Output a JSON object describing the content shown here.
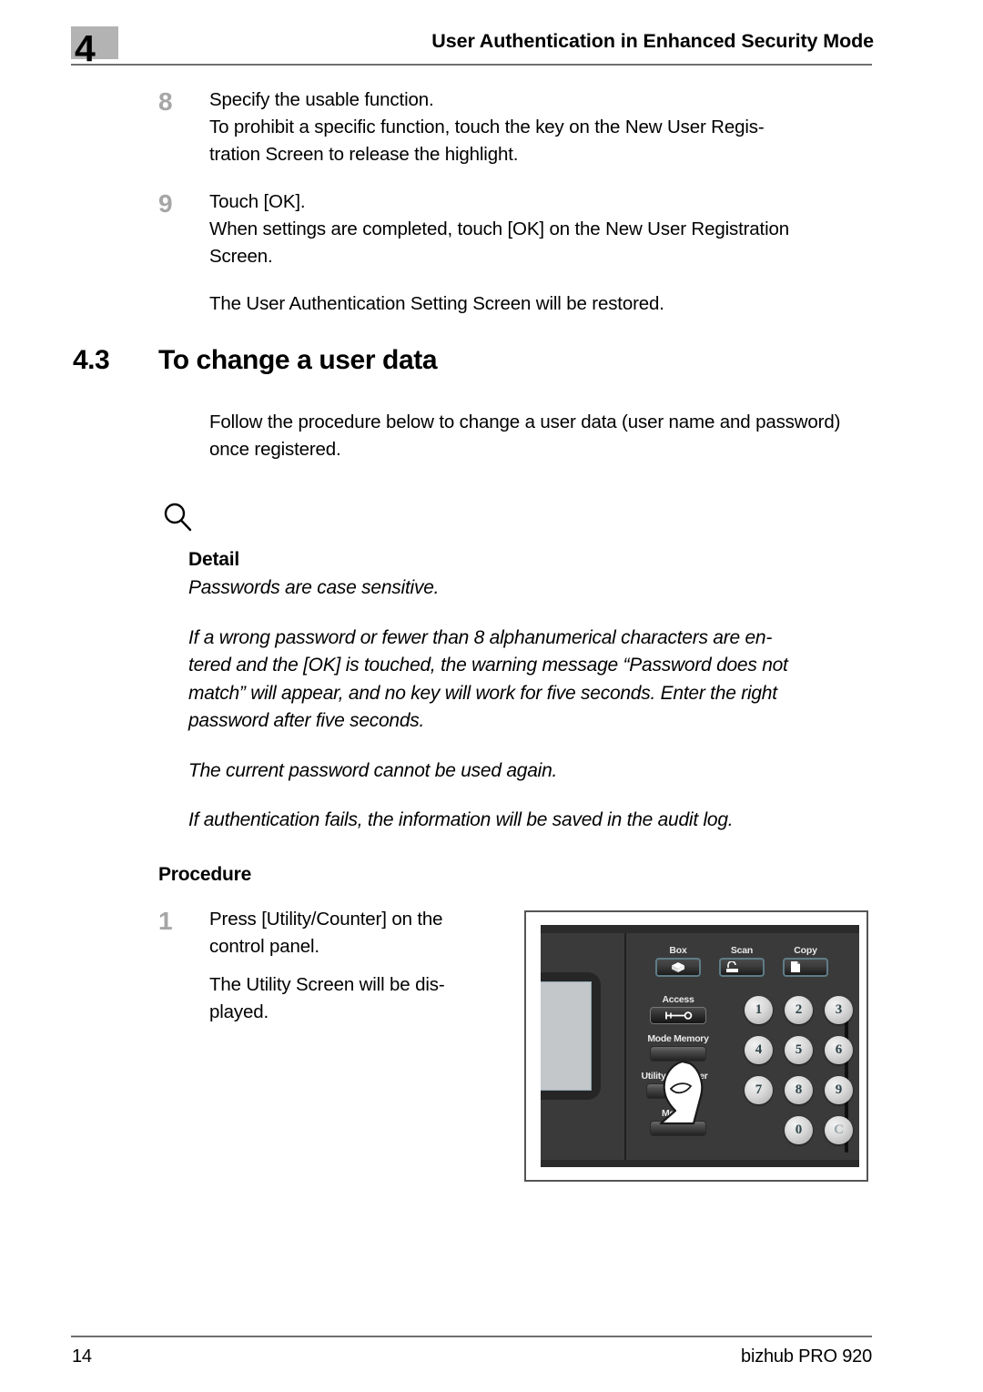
{
  "header": {
    "chapter_number": "4",
    "title": "User Authentication in Enhanced Security Mode"
  },
  "steps_continued": [
    {
      "number": "8",
      "lines": [
        "Specify the usable function.",
        "To prohibit a specific function, touch the key on the New User Regis-",
        "tration Screen to release the highlight."
      ]
    },
    {
      "number": "9",
      "lines": [
        "Touch [OK].",
        "When settings are completed, touch [OK] on the New User Registration",
        "Screen."
      ],
      "result": "The User Authentication Setting Screen will be restored."
    }
  ],
  "section": {
    "number": "4.3",
    "title": "To change a user data",
    "intro_lines": [
      "Follow the procedure below to change a user data (user name and password)",
      "once registered."
    ]
  },
  "detail": {
    "icon": "magnifier-icon",
    "heading": "Detail",
    "paragraphs": [
      [
        "Passwords are case sensitive."
      ],
      [
        "If a wrong password or fewer than 8 alphanumerical characters are en-",
        "tered and the [OK] is touched, the warning message “Password does not",
        "match” will appear, and no key will work for five seconds. Enter the right",
        "password after five seconds."
      ],
      [
        "The current password cannot be used again."
      ],
      [
        "If authentication fails, the information will be saved in the audit log."
      ]
    ]
  },
  "procedure": {
    "heading": "Procedure",
    "step": {
      "number": "1",
      "lines": [
        "Press [Utility/Counter] on the",
        "control panel."
      ],
      "result_lines": [
        "The Utility Screen will be dis-",
        "played."
      ]
    }
  },
  "control_panel": {
    "function_keys": [
      {
        "label": "Box",
        "icon": "box-cube-icon"
      },
      {
        "label": "Scan",
        "icon": "scanner-icon"
      },
      {
        "label": "Copy",
        "icon": "document-page-icon"
      }
    ],
    "side_buttons": [
      {
        "label": "Access",
        "icon": "key-icon"
      },
      {
        "label": "Mode Memory",
        "icon": ""
      },
      {
        "label": "Utility / Counter",
        "icon": ""
      },
      {
        "label": "Mode C",
        "icon": ""
      }
    ],
    "keypad": [
      [
        "1",
        "2",
        "3"
      ],
      [
        "4",
        "5",
        "6"
      ],
      [
        "7",
        "8",
        "9"
      ],
      [
        "",
        "0",
        "C"
      ]
    ],
    "pointer": "pointing-finger-icon"
  },
  "footer": {
    "page_number": "14",
    "product": "bizhub PRO 920"
  },
  "colors": {
    "chapter_badge": "#b3b3b3",
    "step_number": "#a6a6a6",
    "rule": "#6f6f6f",
    "panel_body": "#3a3a3a",
    "lcd": "#c3c7c9",
    "key_face": "#d8d8d8",
    "key_text": "#2e4449",
    "fn_key_border": "#5f7c86"
  }
}
